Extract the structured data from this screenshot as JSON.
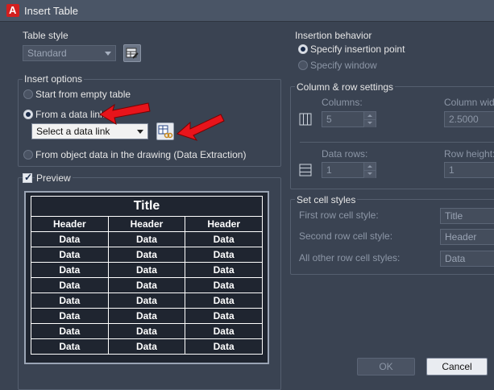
{
  "window": {
    "title": "Insert Table"
  },
  "table_style": {
    "label": "Table style",
    "value": "Standard"
  },
  "insert_options": {
    "label": "Insert options",
    "empty_table": "Start from empty table",
    "data_link": "From a data link",
    "data_link_select": "Select a data link",
    "object_data": "From object data in the drawing (Data Extraction)"
  },
  "preview": {
    "label": "Preview",
    "title": "Title",
    "headers": [
      "Header",
      "Header",
      "Header"
    ],
    "data_cell": "Data"
  },
  "insertion": {
    "label": "Insertion behavior",
    "point": "Specify insertion point",
    "window": "Specify window"
  },
  "colrow": {
    "label": "Column & row settings",
    "columns_label": "Columns:",
    "columns_value": "5",
    "col_width_label": "Column width",
    "col_width_value": "2.5000",
    "data_rows_label": "Data rows:",
    "data_rows_value": "1",
    "row_height_label": "Row height:",
    "row_height_value": "1"
  },
  "cellstyles": {
    "label": "Set cell styles",
    "first_label": "First row cell style:",
    "first_value": "Title",
    "second_label": "Second row cell style:",
    "second_value": "Header",
    "other_label": "All other row cell styles:",
    "other_value": "Data"
  },
  "buttons": {
    "ok": "OK",
    "cancel": "Cancel"
  }
}
